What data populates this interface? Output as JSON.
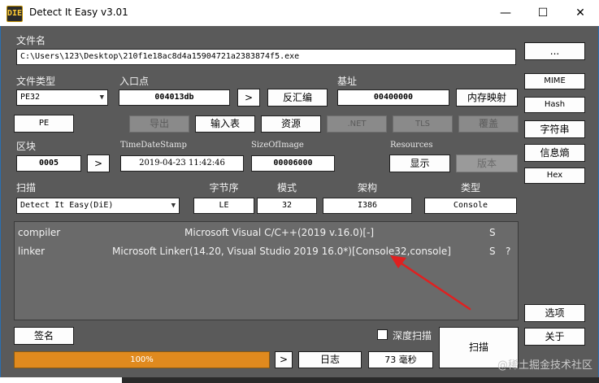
{
  "window": {
    "title": "Detect It Easy v3.01",
    "app_icon_text": "DIE",
    "minimize": "—",
    "maximize": "☐",
    "close": "✕"
  },
  "file": {
    "label": "文件名",
    "path": "C:\\Users\\123\\Desktop\\210f1e18ac8d4a15904721a2383874f5.exe",
    "browse_label": "..."
  },
  "filetype": {
    "label": "文件类型",
    "value": "PE32"
  },
  "entry": {
    "label": "入口点",
    "value": "004013db",
    "go_label": ">",
    "disasm_label": "反汇编"
  },
  "base": {
    "label": "基址",
    "value": "00400000",
    "memmap_label": "内存映射"
  },
  "side_buttons": {
    "mime": "MIME",
    "hash": "Hash",
    "strings": "字符串",
    "entropy": "信息熵",
    "hex": "Hex",
    "options": "选项",
    "about": "关于"
  },
  "pe_row": {
    "pe": "PE",
    "export": "导出",
    "import": "输入表",
    "resources": "资源",
    "net": ".NET",
    "tls": "TLS",
    "overlay": "覆盖"
  },
  "sections": {
    "label": "区块",
    "value": "0005",
    "go_label": ">"
  },
  "timestamp": {
    "label": "TimeDateStamp",
    "value": "2019-04-23 11:42:46"
  },
  "sizeofimage": {
    "label": "SizeOfImage",
    "value": "00006000"
  },
  "resources_block": {
    "label": "Resources",
    "show": "显示",
    "version": "版本"
  },
  "scan": {
    "label": "扫描",
    "engine": "Detect It Easy(DiE)",
    "endian_label": "字节序",
    "endian": "LE",
    "mode_label": "模式",
    "mode": "32",
    "arch_label": "架构",
    "arch": "I386",
    "type_label": "类型",
    "type": "Console"
  },
  "results": [
    {
      "kind": "compiler",
      "name": "Microsoft Visual C/C++(2019 v.16.0)[-]",
      "flag": "S",
      "extra": ""
    },
    {
      "kind": "linker",
      "name": "Microsoft Linker(14.20, Visual Studio 2019 16.0*)[Console32,console]",
      "flag": "S",
      "extra": "?"
    }
  ],
  "bottom": {
    "signature": "签名",
    "deep_scan": "深度扫描",
    "progress_text": "100%",
    "progress_value": 100,
    "go_label": ">",
    "log": "日志",
    "time": "73 毫秒",
    "scan": "扫描"
  },
  "watermark": "@稀土掘金技术社区",
  "colors": {
    "background": "#5a5a5a",
    "progress": "#e08a1e",
    "arrow": "#e02020"
  }
}
